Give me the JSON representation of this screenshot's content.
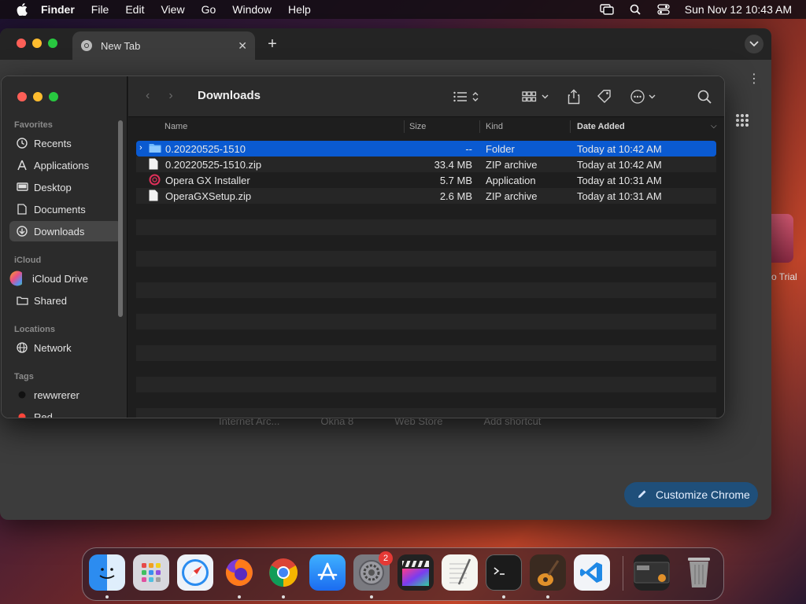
{
  "menubar": {
    "app_name": "Finder",
    "items": [
      "File",
      "Edit",
      "View",
      "Go",
      "Window",
      "Help"
    ],
    "datetime": "Sun Nov 12  10:43 AM"
  },
  "chrome": {
    "tab_title": "New Tab",
    "shortcuts": [
      "Internet Arc...",
      "Okna 8",
      "Web Store",
      "Add shortcut"
    ],
    "customize_label": "Customize Chrome"
  },
  "desktop": {
    "partial_label": "ro Trial"
  },
  "finder": {
    "title": "Downloads",
    "sidebar": {
      "favorites_label": "Favorites",
      "favorites": [
        "Recents",
        "Applications",
        "Desktop",
        "Documents",
        "Downloads"
      ],
      "icloud_label": "iCloud",
      "icloud": [
        "iCloud Drive",
        "Shared"
      ],
      "locations_label": "Locations",
      "locations": [
        "Network"
      ],
      "tags_label": "Tags",
      "tags": [
        "rewwrerer",
        "Red"
      ]
    },
    "columns": {
      "name": "Name",
      "size": "Size",
      "kind": "Kind",
      "date": "Date Added"
    },
    "files": [
      {
        "name": "0.20220525-1510",
        "size": "--",
        "kind": "Folder",
        "date": "Today at 10:42 AM"
      },
      {
        "name": "0.20220525-1510.zip",
        "size": "33.4 MB",
        "kind": "ZIP archive",
        "date": "Today at 10:42 AM"
      },
      {
        "name": "Opera GX Installer",
        "size": "5.7 MB",
        "kind": "Application",
        "date": "Today at 10:31 AM"
      },
      {
        "name": "OperaGXSetup.zip",
        "size": "2.6 MB",
        "kind": "ZIP archive",
        "date": "Today at 10:31 AM"
      }
    ]
  },
  "dock": {
    "settings_badge": "2"
  }
}
